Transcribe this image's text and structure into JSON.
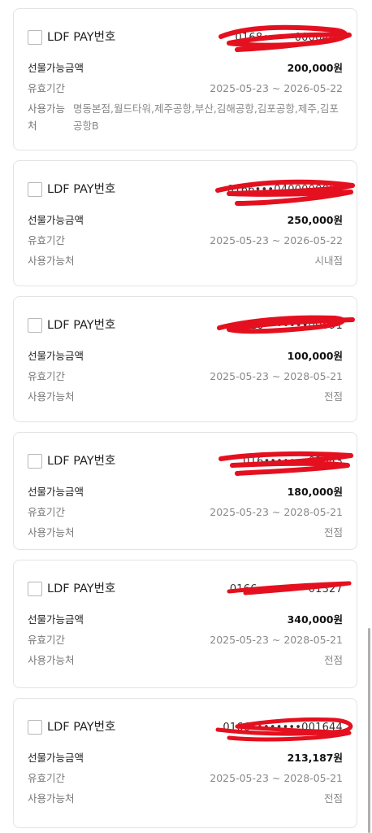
{
  "cards": [
    {
      "pay_label": "LDF PAY번호",
      "pay_number": "0168•••••0000401",
      "amount_label": "선물가능금액",
      "amount": "200,000원",
      "validity_label": "유효기간",
      "validity": "2025-05-23 ~ 2026-05-22",
      "usable_label": "사용가능처",
      "usable": "명동본점,월드타워,제주공항,부산,김해공항,김포공항,제주,김포공항B"
    },
    {
      "pay_label": "LDF PAY번호",
      "pay_number": "0166•••0400000001",
      "amount_label": "선물가능금액",
      "amount": "250,000원",
      "validity_label": "유효기간",
      "validity": "2025-05-23 ~ 2026-05-22",
      "usable_label": "사용가능처",
      "usable": "시내점"
    },
    {
      "pay_label": "LDF PAY번호",
      "pay_number": "016•••••••00591",
      "amount_label": "선물가능금액",
      "amount": "100,000원",
      "validity_label": "유효기간",
      "validity": "2025-05-23 ~ 2028-05-21",
      "usable_label": "사용가능처",
      "usable": "전점"
    },
    {
      "pay_label": "LDF PAY번호",
      "pay_number": "016•••••••01043",
      "amount_label": "선물가능금액",
      "amount": "180,000원",
      "validity_label": "유효기간",
      "validity": "2025-05-23 ~ 2028-05-21",
      "usable_label": "사용가능처",
      "usable": "전점"
    },
    {
      "pay_label": "LDF PAY번호",
      "pay_number": "0166••••••••01327",
      "amount_label": "선물가능금액",
      "amount": "340,000원",
      "validity_label": "유효기간",
      "validity": "2025-05-23 ~ 2028-05-21",
      "usable_label": "사용가능처",
      "usable": "전점"
    },
    {
      "pay_label": "LDF PAY번호",
      "pay_number": "0166••••••••001644",
      "amount_label": "선물가능금액",
      "amount": "213,187원",
      "validity_label": "유효기간",
      "validity": "2025-05-23 ~ 2028-05-21",
      "usable_label": "사용가능처",
      "usable": "전점"
    }
  ],
  "colors": {
    "redaction": "#e5101f",
    "border": "#e3e3e3",
    "muted_text": "#888888",
    "strong_text": "#111111"
  }
}
